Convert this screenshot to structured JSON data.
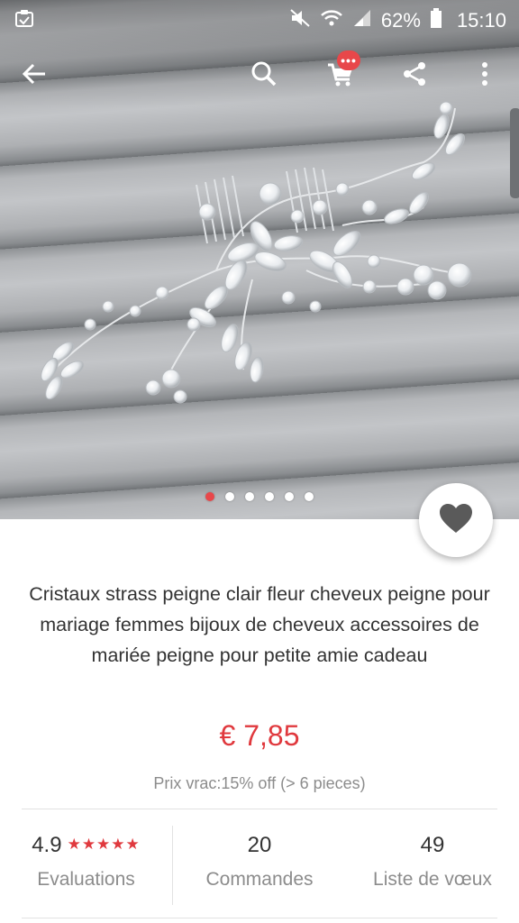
{
  "status_bar": {
    "battery": "62%",
    "time": "15:10"
  },
  "toolbar": {
    "cart_badge": "•••"
  },
  "gallery": {
    "slide_count": 6,
    "active_index": 0
  },
  "product": {
    "title": "Cristaux strass peigne clair fleur cheveux peigne pour mariage femmes bijoux de cheveux accessoires de mariée peigne pour petite amie cadeau",
    "price": "€ 7,85",
    "bulk_price": "Prix vrac:15% off (> 6 pieces)"
  },
  "stats": {
    "rating": "4.9",
    "stars": "★★★★★",
    "rating_label": "Evaluations",
    "orders": "20",
    "orders_label": "Commandes",
    "wishlist": "49",
    "wishlist_label": "Liste de vœux"
  },
  "colors": {
    "accent": "#e0393e",
    "badge": "#e8474a",
    "text": "#333333",
    "muted": "#8c8c8c"
  },
  "icons": {
    "back": "arrow-left-icon",
    "search": "search-icon",
    "cart": "cart-icon",
    "share": "share-icon",
    "more": "more-vertical-icon",
    "wishlist": "heart-icon"
  }
}
